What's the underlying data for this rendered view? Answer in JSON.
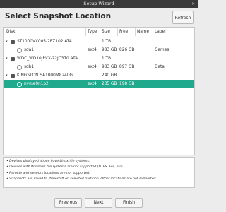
{
  "window": {
    "title": "Setup Wizard",
    "min_glyph": "–",
    "close_glyph": "×"
  },
  "header": {
    "title": "Select Snapshot Location",
    "refresh_label": "Refresh"
  },
  "table": {
    "columns": [
      "Disk",
      "Type",
      "Size",
      "Free",
      "Name",
      "Label"
    ],
    "rows": [
      {
        "kind": "disk",
        "disk": "ST1000VX005-2EZ102 ATA",
        "type": "",
        "size": "1 TB",
        "free": "",
        "name": "",
        "label": ""
      },
      {
        "kind": "partition",
        "disk": "sda1",
        "type": "ext4",
        "size": "983 GB",
        "free": "826 GB",
        "name": "",
        "label": "Games",
        "selected": false
      },
      {
        "kind": "disk",
        "disk": "WDC_WD10JPVX-22JC3T0 ATA",
        "type": "",
        "size": "1 TB",
        "free": "",
        "name": "",
        "label": ""
      },
      {
        "kind": "partition",
        "disk": "sdb1",
        "type": "ext4",
        "size": "983 GB",
        "free": "897 GB",
        "name": "",
        "label": "Data",
        "selected": false
      },
      {
        "kind": "disk",
        "disk": "KINGSTON SA1000M8240G",
        "type": "",
        "size": "240 GB",
        "free": "",
        "name": "",
        "label": ""
      },
      {
        "kind": "partition",
        "disk": "nvme0n1p2",
        "type": "ext4",
        "size": "235 GB",
        "free": "198 GB",
        "name": "",
        "label": "",
        "selected": true
      }
    ]
  },
  "info": [
    "• Devices displayed above have Linux file systems.",
    "• Devices with Windows file systems are not supported (NTFS, FAT, etc).",
    "• Remote and network locations are not supported.",
    "• Snapshots are saved to /timeshift on selected partition. Other locations are not supported."
  ],
  "footer": {
    "previous": "Previous",
    "next": "Next",
    "finish": "Finish"
  },
  "colors": {
    "selection": "#20a98d",
    "titlebar": "#3a3a3a"
  }
}
